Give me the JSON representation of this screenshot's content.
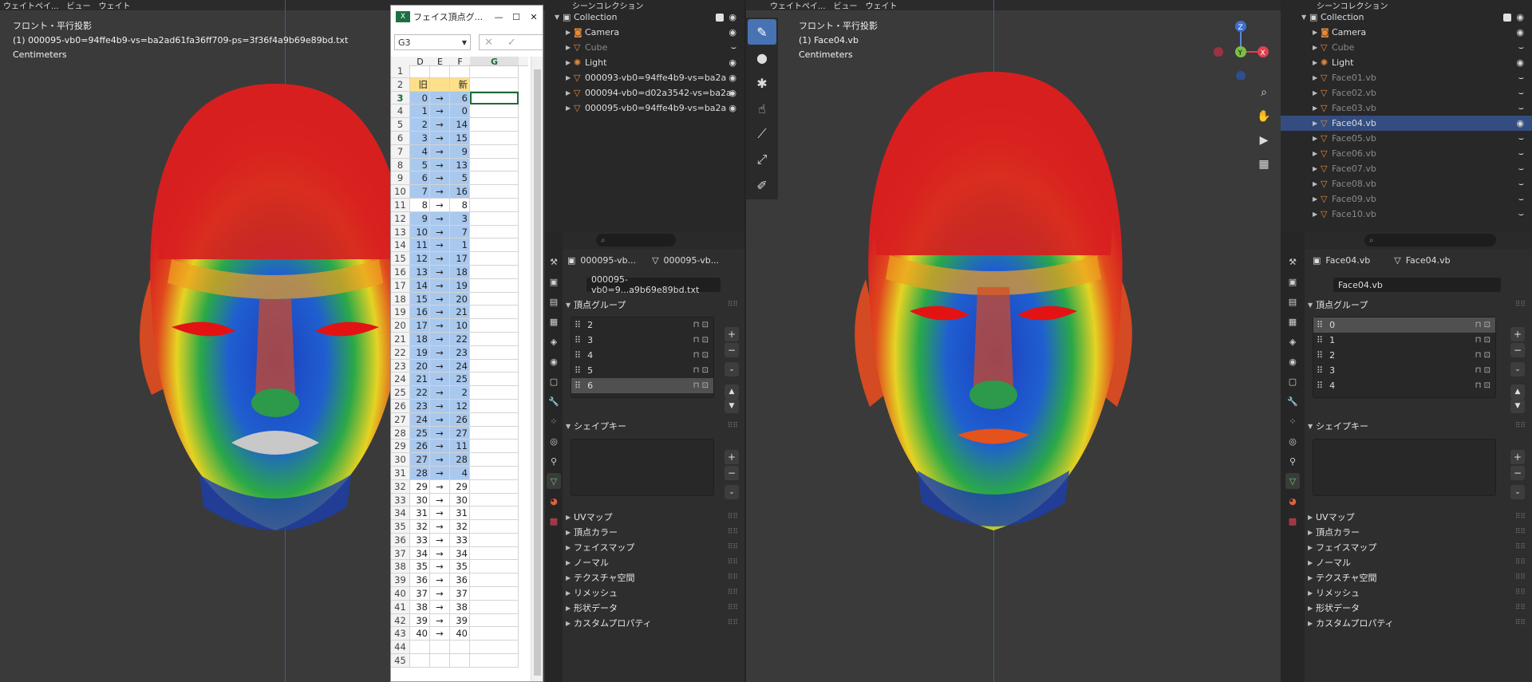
{
  "left_viewport": {
    "menu": [
      "ウェイトペイ...",
      "ビュー",
      "ウェイト"
    ],
    "line1": "フロント・平行投影",
    "line2": "(1) 000095-vb0=94ffe4b9-vs=ba2ad61fa36ff709-ps=3f36f4a9b69e89bd.txt",
    "line3": "Centimeters"
  },
  "right_viewport": {
    "menu": [
      "ウェイトペイ...",
      "ビュー",
      "ウェイト"
    ],
    "line1": "フロント・平行投影",
    "line2": "(1) Face04.vb",
    "line3": "Centimeters",
    "gizmo": {
      "z": "Z",
      "y": "Y",
      "x": "X"
    }
  },
  "excel": {
    "title": "フェイス頂点グ...",
    "namebox": "G3",
    "columns": [
      "D",
      "E",
      "F",
      "G"
    ],
    "rows": [
      {
        "n": "1",
        "d": "",
        "e": "",
        "f": ""
      },
      {
        "n": "2",
        "d": "旧",
        "e": "",
        "f": "新"
      },
      {
        "n": "3",
        "d": "0",
        "e": "→",
        "f": "6"
      },
      {
        "n": "4",
        "d": "1",
        "e": "→",
        "f": "0"
      },
      {
        "n": "5",
        "d": "2",
        "e": "→",
        "f": "14"
      },
      {
        "n": "6",
        "d": "3",
        "e": "→",
        "f": "15"
      },
      {
        "n": "7",
        "d": "4",
        "e": "→",
        "f": "9"
      },
      {
        "n": "8",
        "d": "5",
        "e": "→",
        "f": "13"
      },
      {
        "n": "9",
        "d": "6",
        "e": "→",
        "f": "5"
      },
      {
        "n": "10",
        "d": "7",
        "e": "→",
        "f": "16"
      },
      {
        "n": "11",
        "d": "8",
        "e": "→",
        "f": "8"
      },
      {
        "n": "12",
        "d": "9",
        "e": "→",
        "f": "3"
      },
      {
        "n": "13",
        "d": "10",
        "e": "→",
        "f": "7"
      },
      {
        "n": "14",
        "d": "11",
        "e": "→",
        "f": "1"
      },
      {
        "n": "15",
        "d": "12",
        "e": "→",
        "f": "17"
      },
      {
        "n": "16",
        "d": "13",
        "e": "→",
        "f": "18"
      },
      {
        "n": "17",
        "d": "14",
        "e": "→",
        "f": "19"
      },
      {
        "n": "18",
        "d": "15",
        "e": "→",
        "f": "20"
      },
      {
        "n": "19",
        "d": "16",
        "e": "→",
        "f": "21"
      },
      {
        "n": "20",
        "d": "17",
        "e": "→",
        "f": "10"
      },
      {
        "n": "21",
        "d": "18",
        "e": "→",
        "f": "22"
      },
      {
        "n": "22",
        "d": "19",
        "e": "→",
        "f": "23"
      },
      {
        "n": "23",
        "d": "20",
        "e": "→",
        "f": "24"
      },
      {
        "n": "24",
        "d": "21",
        "e": "→",
        "f": "25"
      },
      {
        "n": "25",
        "d": "22",
        "e": "→",
        "f": "2"
      },
      {
        "n": "26",
        "d": "23",
        "e": "→",
        "f": "12"
      },
      {
        "n": "27",
        "d": "24",
        "e": "→",
        "f": "26"
      },
      {
        "n": "28",
        "d": "25",
        "e": "→",
        "f": "27"
      },
      {
        "n": "29",
        "d": "26",
        "e": "→",
        "f": "11"
      },
      {
        "n": "30",
        "d": "27",
        "e": "→",
        "f": "28"
      },
      {
        "n": "31",
        "d": "28",
        "e": "→",
        "f": "4"
      },
      {
        "n": "32",
        "d": "29",
        "e": "→",
        "f": "29"
      },
      {
        "n": "33",
        "d": "30",
        "e": "→",
        "f": "30"
      },
      {
        "n": "34",
        "d": "31",
        "e": "→",
        "f": "31"
      },
      {
        "n": "35",
        "d": "32",
        "e": "→",
        "f": "32"
      },
      {
        "n": "36",
        "d": "33",
        "e": "→",
        "f": "33"
      },
      {
        "n": "37",
        "d": "34",
        "e": "→",
        "f": "34"
      },
      {
        "n": "38",
        "d": "35",
        "e": "→",
        "f": "35"
      },
      {
        "n": "39",
        "d": "36",
        "e": "→",
        "f": "36"
      },
      {
        "n": "40",
        "d": "37",
        "e": "→",
        "f": "37"
      },
      {
        "n": "41",
        "d": "38",
        "e": "→",
        "f": "38"
      },
      {
        "n": "42",
        "d": "39",
        "e": "→",
        "f": "39"
      },
      {
        "n": "43",
        "d": "40",
        "e": "→",
        "f": "40"
      },
      {
        "n": "44",
        "d": "",
        "e": "",
        "f": ""
      },
      {
        "n": "45",
        "d": "",
        "e": "",
        "f": ""
      }
    ]
  },
  "left_outliner": {
    "title": "シーンコレクション",
    "items": [
      {
        "label": "Collection",
        "type": "collection"
      },
      {
        "label": "Camera",
        "type": "camera"
      },
      {
        "label": "Cube",
        "type": "mesh",
        "dim": true
      },
      {
        "label": "Light",
        "type": "light"
      },
      {
        "label": "000093-vb0=94ffe4b9-vs=ba2a",
        "type": "mesh"
      },
      {
        "label": "000094-vb0=d02a3542-vs=ba2a",
        "type": "mesh"
      },
      {
        "label": "000095-vb0=94ffe4b9-vs=ba2a",
        "type": "mesh"
      }
    ]
  },
  "right_outliner": {
    "title": "シーンコレクション",
    "items": [
      {
        "label": "Collection",
        "type": "collection"
      },
      {
        "label": "Camera",
        "type": "camera"
      },
      {
        "label": "Cube",
        "type": "mesh",
        "dim": true
      },
      {
        "label": "Light",
        "type": "light"
      },
      {
        "label": "Face01.vb",
        "type": "mesh",
        "dim": true
      },
      {
        "label": "Face02.vb",
        "type": "mesh",
        "dim": true
      },
      {
        "label": "Face03.vb",
        "type": "mesh",
        "dim": true
      },
      {
        "label": "Face04.vb",
        "type": "mesh",
        "selected": true
      },
      {
        "label": "Face05.vb",
        "type": "mesh",
        "dim": true
      },
      {
        "label": "Face06.vb",
        "type": "mesh",
        "dim": true
      },
      {
        "label": "Face07.vb",
        "type": "mesh",
        "dim": true
      },
      {
        "label": "Face08.vb",
        "type": "mesh",
        "dim": true
      },
      {
        "label": "Face09.vb",
        "type": "mesh",
        "dim": true
      },
      {
        "label": "Face10.vb",
        "type": "mesh",
        "dim": true
      }
    ]
  },
  "left_props": {
    "object": "000095-vb...",
    "mesh": "000095-vb...",
    "data_name": "000095-vb0=9...a9b69e89bd.txt",
    "vg_header": "頂点グループ",
    "vgroups": [
      "2",
      "3",
      "4",
      "5",
      "6"
    ],
    "vg_selected": 4,
    "sk_header": "シェイプキー",
    "panels": [
      "UVマップ",
      "頂点カラー",
      "フェイスマップ",
      "ノーマル",
      "テクスチャ空間",
      "リメッシュ",
      "形状データ",
      "カスタムプロパティ"
    ]
  },
  "right_props": {
    "object": "Face04.vb",
    "mesh": "Face04.vb",
    "data_name": "Face04.vb",
    "vg_header": "頂点グループ",
    "vgroups": [
      "0",
      "1",
      "2",
      "3",
      "4"
    ],
    "vg_selected": 0,
    "sk_header": "シェイプキー",
    "panels": [
      "UVマップ",
      "頂点カラー",
      "フェイスマップ",
      "ノーマル",
      "テクスチャ空間",
      "リメッシュ",
      "形状データ",
      "カスタムプロパティ"
    ]
  }
}
